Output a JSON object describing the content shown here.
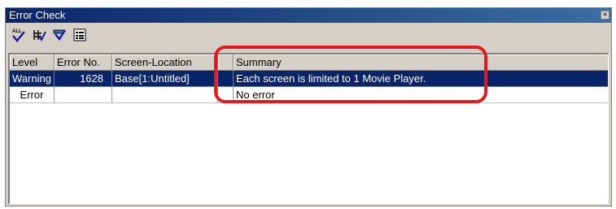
{
  "window": {
    "title": "Error Check",
    "close_glyph": "×"
  },
  "toolbar": {
    "buttons": [
      {
        "icon": "check-all-icon",
        "text": "ALL"
      },
      {
        "icon": "grid-check-icon"
      },
      {
        "icon": "funnel-check-icon"
      },
      {
        "icon": "properties-list-icon"
      }
    ]
  },
  "table": {
    "columns": [
      "Level",
      "Error No.",
      "Screen-Location",
      "",
      "Summary"
    ],
    "rows": [
      {
        "level": "Warning",
        "error_no": "1628",
        "location": "Base[1:Untitled]",
        "summary": "Each screen is limited to 1 Movie Player.",
        "selected": true
      },
      {
        "level": "Error",
        "error_no": "",
        "location": "",
        "summary": "No error",
        "selected": false
      }
    ]
  },
  "colors": {
    "selection": "#0a246a",
    "annotation": "#e4191e"
  }
}
